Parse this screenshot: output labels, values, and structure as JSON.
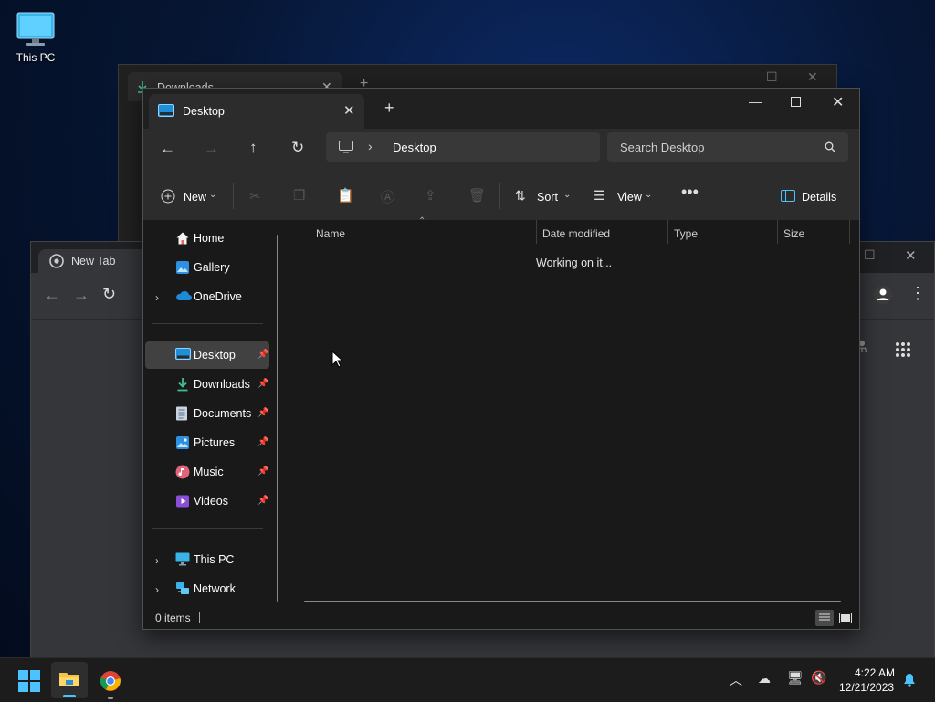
{
  "desktop": {
    "icon_label": "This PC"
  },
  "downloads_window": {
    "tab_title": "Downloads"
  },
  "chrome_window": {
    "tab_title": "New Tab"
  },
  "explorer": {
    "tab_title": "Desktop",
    "breadcrumb": "Desktop",
    "search_placeholder": "Search Desktop",
    "toolbar": {
      "new_label": "New",
      "sort_label": "Sort",
      "view_label": "View",
      "details_label": "Details"
    },
    "sidebar": {
      "top": [
        {
          "label": "Home",
          "icon": "home-icon"
        },
        {
          "label": "Gallery",
          "icon": "gallery-icon"
        },
        {
          "label": "OneDrive",
          "icon": "onedrive-icon"
        }
      ],
      "pinned": [
        {
          "label": "Desktop",
          "icon": "desktop-folder-icon"
        },
        {
          "label": "Downloads",
          "icon": "downloads-icon"
        },
        {
          "label": "Documents",
          "icon": "documents-icon"
        },
        {
          "label": "Pictures",
          "icon": "pictures-icon"
        },
        {
          "label": "Music",
          "icon": "music-icon"
        },
        {
          "label": "Videos",
          "icon": "videos-icon"
        }
      ],
      "bottom": [
        {
          "label": "This PC",
          "icon": "this-pc-icon"
        },
        {
          "label": "Network",
          "icon": "network-icon"
        }
      ]
    },
    "columns": [
      "Name",
      "Date modified",
      "Type",
      "Size"
    ],
    "loading_text": "Working on it...",
    "status_text": "0 items"
  },
  "taskbar": {
    "time": "4:22 AM",
    "date": "12/21/2023"
  },
  "colors": {
    "accent": "#4cc2ff",
    "window_bg": "#191919",
    "toolbar_bg": "#2c2c2c"
  }
}
